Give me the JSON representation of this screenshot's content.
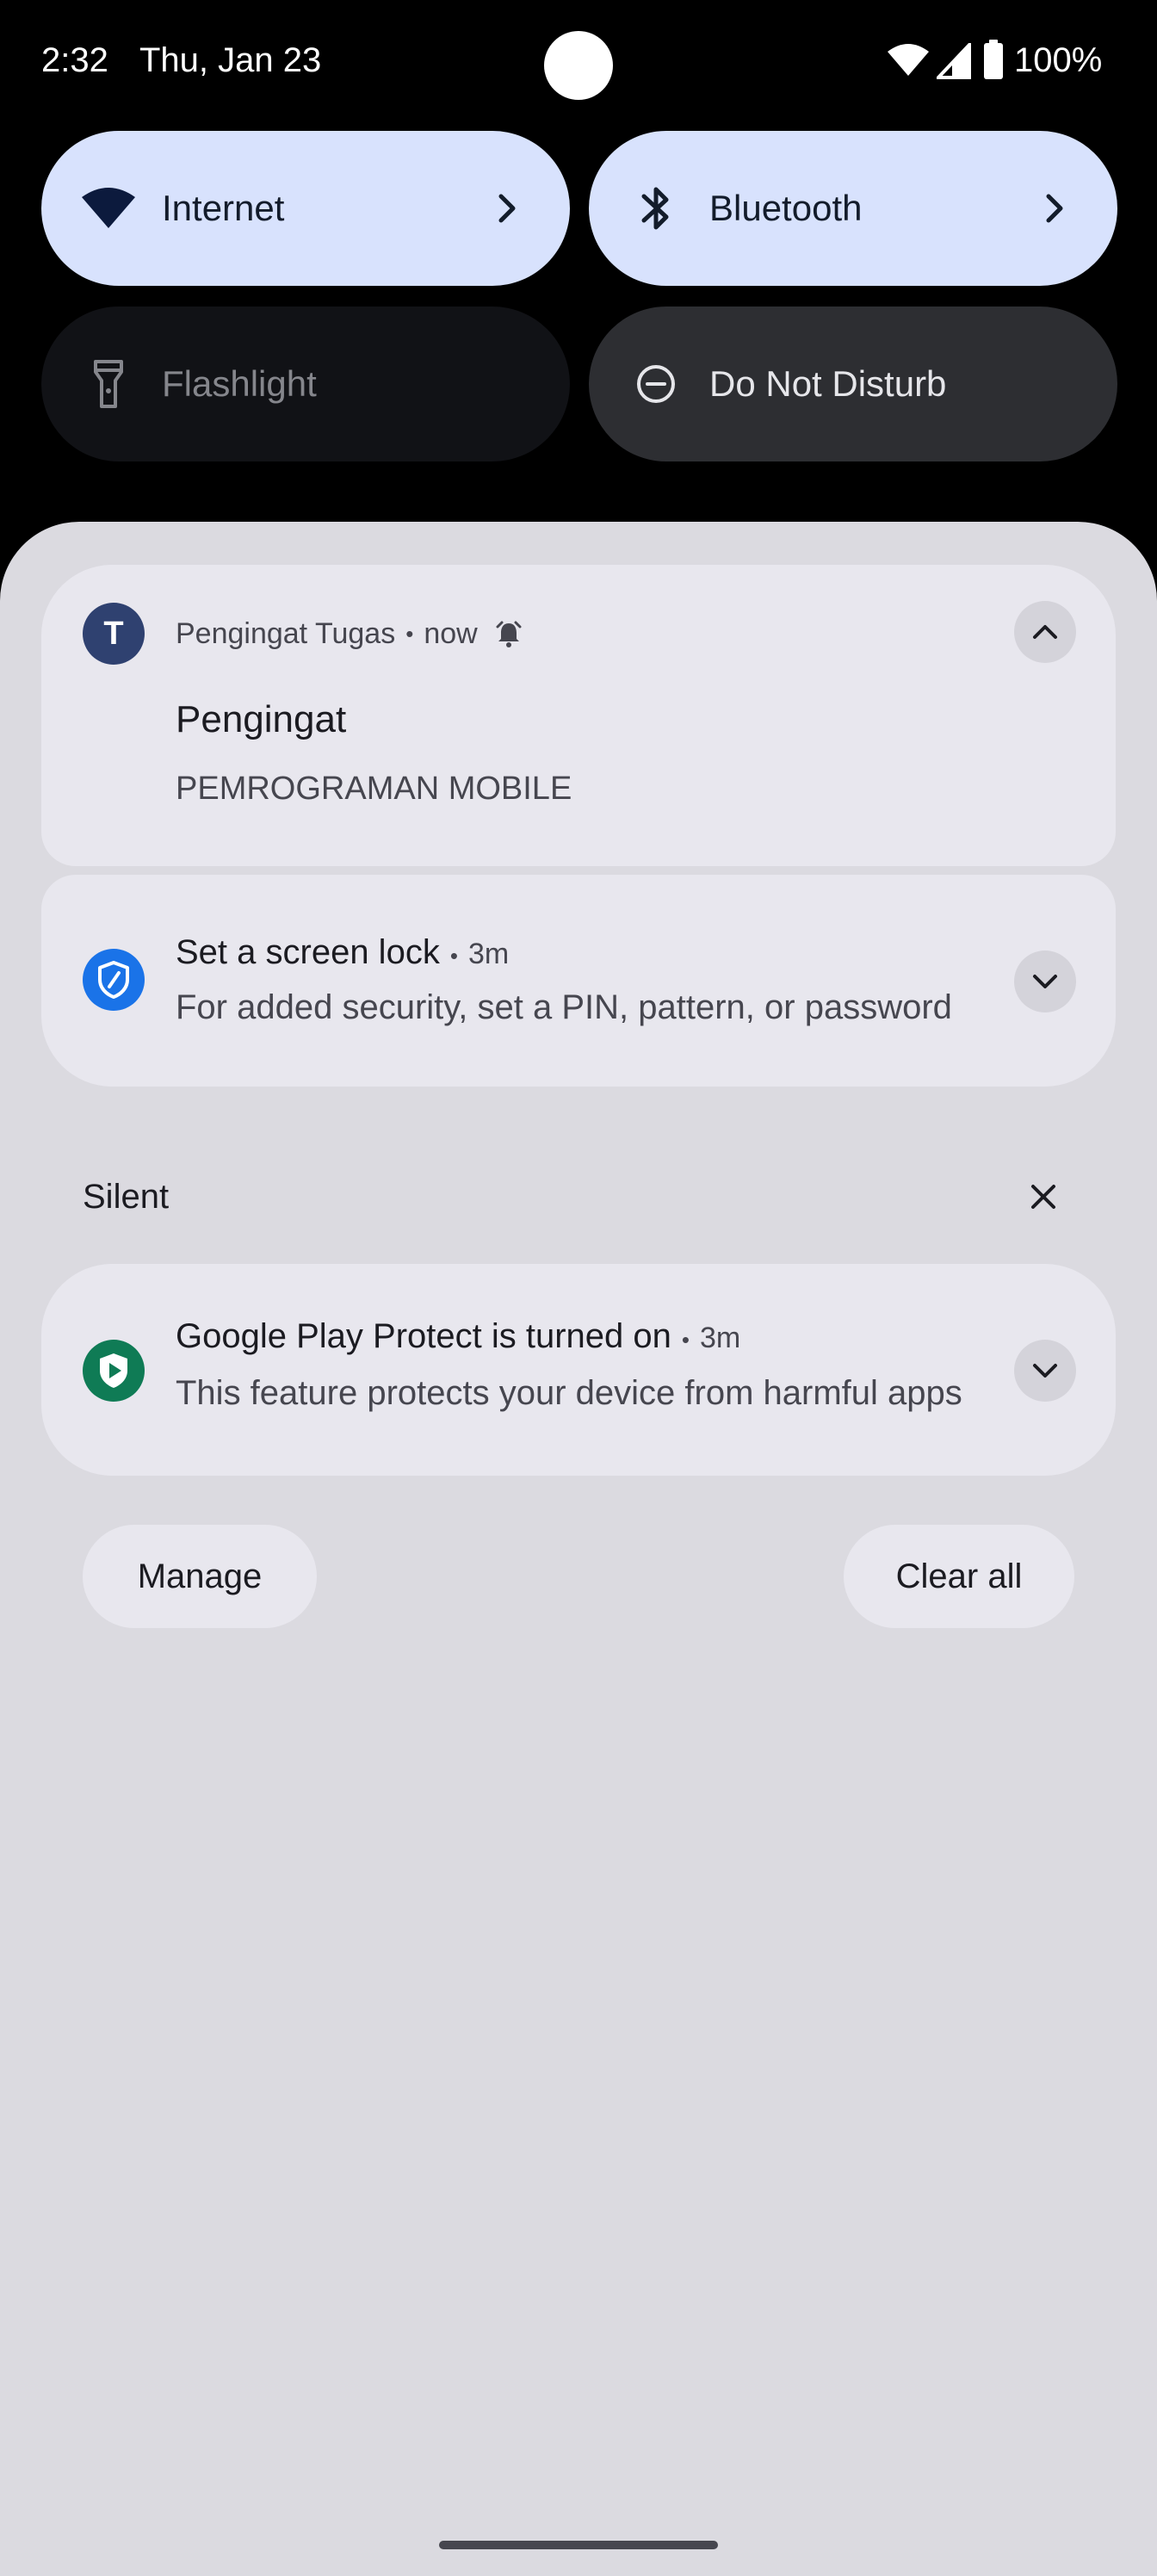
{
  "status_bar": {
    "time": "2:32",
    "date": "Thu, Jan 23",
    "battery": "100%",
    "icons": [
      "wifi-icon",
      "signal-icon",
      "battery-icon"
    ]
  },
  "quick_settings": {
    "internet": {
      "label": "Internet",
      "icon": "wifi-icon",
      "state": "on"
    },
    "bluetooth": {
      "label": "Bluetooth",
      "icon": "bluetooth-icon",
      "state": "on"
    },
    "flashlight": {
      "label": "Flashlight",
      "icon": "flashlight-icon",
      "state": "off"
    },
    "dnd": {
      "label": "Do Not Disturb",
      "icon": "do-not-disturb-icon",
      "state": "off"
    }
  },
  "notifications": [
    {
      "app_letter": "T",
      "app_name": "Pengingat Tugas",
      "time": "now",
      "title": "Pengingat",
      "text": "PEMROGRAMAN MOBILE",
      "expanded": true
    },
    {
      "title": "Set a screen lock",
      "time": "3m",
      "text": "For added security, set a PIN, pattern, or password",
      "expanded": false
    }
  ],
  "silent_section": {
    "label": "Silent",
    "items": [
      {
        "title": "Google Play Protect is turned on",
        "time": "3m",
        "text": "This feature protects your device from harmful apps",
        "expanded": false
      }
    ]
  },
  "actions": {
    "manage": "Manage",
    "clear_all": "Clear all"
  },
  "colors": {
    "tile_active": "#d8e2fd",
    "shade_bg": "#dbdae0",
    "card_bg": "#e8e7ee",
    "avatar_app": "#2f4170",
    "shield_blue": "#1a73e8",
    "play_protect_green": "#0f7b55"
  },
  "separator": "•"
}
